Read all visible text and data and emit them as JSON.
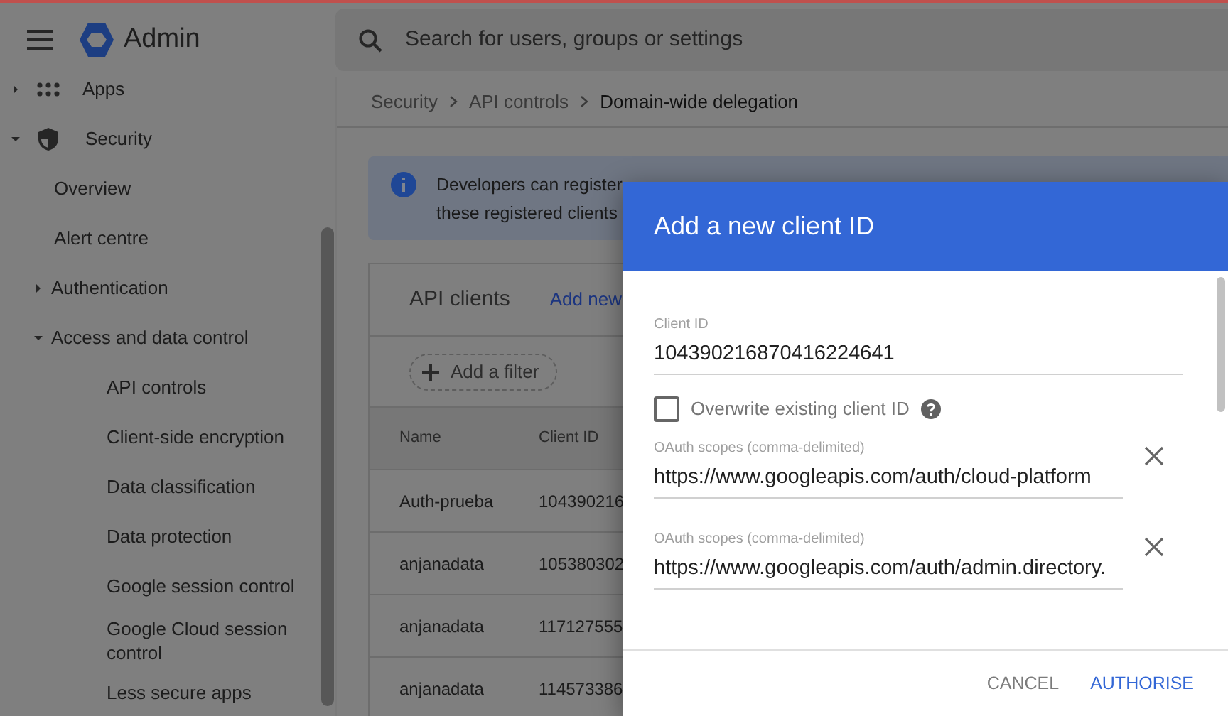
{
  "topbar": {
    "app_name": "Admin",
    "search_placeholder": "Search for users, groups or settings"
  },
  "sidebar": {
    "items": [
      {
        "label": "Apps",
        "expanded": false
      },
      {
        "label": "Security",
        "expanded": true,
        "children": [
          {
            "label": "Overview"
          },
          {
            "label": "Alert centre"
          },
          {
            "label": "Authentication",
            "expanded": false
          },
          {
            "label": "Access and data control",
            "expanded": true,
            "children": [
              {
                "label": "API controls"
              },
              {
                "label": "Client-side encryption"
              },
              {
                "label": "Data classification"
              },
              {
                "label": "Data protection"
              },
              {
                "label": "Google session control"
              },
              {
                "label": "Google Cloud session control"
              },
              {
                "label": "Less secure apps"
              }
            ]
          }
        ]
      }
    ]
  },
  "breadcrumb": [
    {
      "label": "Security",
      "current": false
    },
    {
      "label": "API controls",
      "current": false
    },
    {
      "label": "Domain-wide delegation",
      "current": true
    }
  ],
  "banner": {
    "lines": [
      "Developers can register",
      "these registered clients"
    ]
  },
  "card": {
    "title": "API clients",
    "link": "Add new",
    "filter": "Add a filter",
    "table": {
      "columns": [
        "Name",
        "Client ID"
      ],
      "rows": [
        [
          "Auth-prueba",
          "104390216"
        ],
        [
          "anjanadata",
          "105380302"
        ],
        [
          "anjanadata",
          "117127555"
        ],
        [
          "anjanadata",
          "114573386"
        ]
      ]
    }
  },
  "dialog": {
    "title": "Add a new client ID",
    "client_id": {
      "label": "Client ID",
      "value": "104390216870416224641"
    },
    "overwrite": {
      "label": "Overwrite existing client ID",
      "checked": false
    },
    "scopes": [
      {
        "label": "OAuth scopes (comma-delimited)",
        "value": "https://www.googleapis.com/auth/cloud-platform"
      },
      {
        "label": "OAuth scopes (comma-delimited)",
        "value": "https://www.googleapis.com/auth/admin.directory."
      }
    ],
    "buttons": [
      {
        "label": "CANCEL",
        "kind": "secondary"
      },
      {
        "label": "AUTHORISE",
        "kind": "primary"
      }
    ]
  }
}
